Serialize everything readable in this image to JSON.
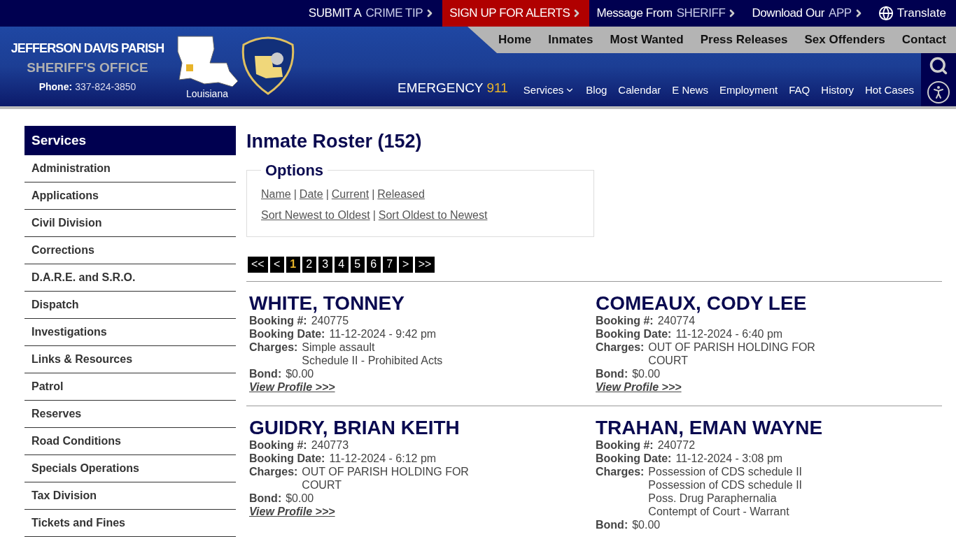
{
  "top_bar": [
    {
      "lead": "SUBMIT A",
      "accent": "CRIME TIP",
      "highlighted": false
    },
    {
      "lead": "SIGN UP FOR ALERTS",
      "highlighted": true
    },
    {
      "lead": "Message From",
      "accent": "SHERIFF",
      "highlighted": false
    },
    {
      "lead": "Download Our",
      "accent": "APP",
      "highlighted": false
    }
  ],
  "translate": "Translate",
  "brand": {
    "title": "JEFFERSON DAVIS PARISH",
    "subtitle": "SHERIFF'S OFFICE",
    "phone_label": "Phone:",
    "phone": "337-824-3850",
    "map_caption": "Louisiana"
  },
  "main_nav": [
    "Home",
    "Inmates",
    "Most Wanted",
    "Press Releases",
    "Sex Offenders",
    "Contact"
  ],
  "emergency": {
    "label": "EMERGENCY",
    "number": "911"
  },
  "sub_nav": [
    {
      "label": "Services",
      "dropdown": true
    },
    {
      "label": "Blog",
      "dropdown": false
    },
    {
      "label": "Calendar",
      "dropdown": false
    },
    {
      "label": "E News",
      "dropdown": false
    },
    {
      "label": "Employment",
      "dropdown": false
    },
    {
      "label": "FAQ",
      "dropdown": false
    },
    {
      "label": "History",
      "dropdown": false
    },
    {
      "label": "Hot Cases",
      "dropdown": false
    }
  ],
  "sidebar": {
    "title": "Services",
    "items": [
      "Administration",
      "Applications",
      "Civil Division",
      "Corrections",
      "D.A.R.E. and S.R.O.",
      "Dispatch",
      "Investigations",
      "Links & Resources",
      "Patrol",
      "Reserves",
      "Road Conditions",
      "Specials Operations",
      "Tax Division",
      "Tickets and Fines"
    ]
  },
  "page_title": "Inmate Roster (152)",
  "options": {
    "title": "Options",
    "row_1": [
      "Name",
      "Date",
      "Current",
      "Released"
    ],
    "row_2": [
      "Sort Newest to Oldest",
      "Sort Oldest to Newest"
    ],
    "separators": [
      "|",
      "|",
      "|",
      "|"
    ]
  },
  "pagination": [
    {
      "label": "<<",
      "selected": false
    },
    {
      "label": "<",
      "selected": false
    },
    {
      "label": "1",
      "selected": true
    },
    {
      "label": "2",
      "selected": false
    },
    {
      "label": "3",
      "selected": false
    },
    {
      "label": "4",
      "selected": false
    },
    {
      "label": "5",
      "selected": false
    },
    {
      "label": "6",
      "selected": false
    },
    {
      "label": "7",
      "selected": false
    },
    {
      "label": ">",
      "selected": false
    },
    {
      "label": ">>",
      "selected": false
    }
  ],
  "inmates": [
    {
      "name": "WHITE, TONNEY",
      "labels": {
        "booking_no": "Booking #:",
        "booking_date": "Booking Date:",
        "charges": "Charges:",
        "bond": "Bond:"
      },
      "booking_no": "240775",
      "booking_date": "11-12-2024 - 9:42 pm",
      "charges": [
        "Simple assault",
        "Schedule II - Prohibited Acts"
      ],
      "bond": "$0.00",
      "link": "View Profile >>>"
    },
    {
      "name": "COMEAUX, CODY LEE",
      "labels": {
        "booking_no": "Booking #:",
        "booking_date": "Booking Date:",
        "charges": "Charges:",
        "bond": "Bond:"
      },
      "booking_no": "240774",
      "booking_date": "11-12-2024 - 6:40 pm",
      "charges": [
        "OUT OF PARISH HOLDING FOR COURT"
      ],
      "bond": "$0.00",
      "link": "View Profile >>>"
    },
    {
      "name": "GUIDRY, BRIAN KEITH",
      "labels": {
        "booking_no": "Booking #:",
        "booking_date": "Booking Date:",
        "charges": "Charges:",
        "bond": "Bond:"
      },
      "booking_no": "240773",
      "booking_date": "11-12-2024 - 6:12 pm",
      "charges": [
        "OUT OF PARISH HOLDING FOR COURT"
      ],
      "bond": "$0.00",
      "link": "View Profile >>>"
    },
    {
      "name": "TRAHAN, EMAN WAYNE",
      "labels": {
        "booking_no": "Booking #:",
        "booking_date": "Booking Date:",
        "charges": "Charges:",
        "bond": "Bond:"
      },
      "booking_no": "240772",
      "booking_date": "11-12-2024 - 3:08 pm",
      "charges": [
        "Possession of CDS schedule II",
        "Possession of CDS schedule II",
        "Poss. Drug Paraphernalia",
        "Contempt of Court - Warrant"
      ],
      "bond": "$0.00"
    }
  ]
}
